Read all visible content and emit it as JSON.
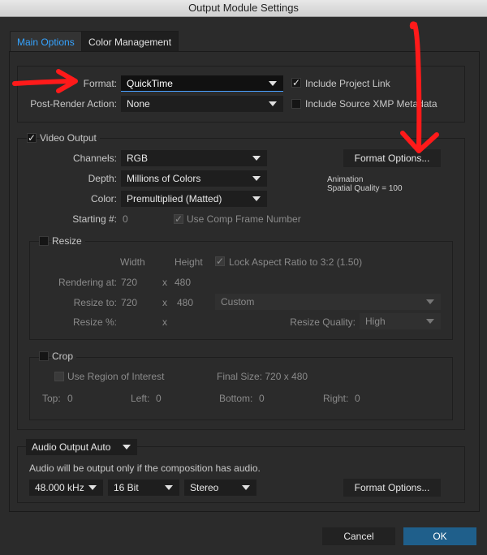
{
  "window": {
    "title": "Output Module Settings"
  },
  "tabs": {
    "main": "Main Options",
    "color": "Color Management"
  },
  "format": {
    "label": "Format:",
    "value": "QuickTime",
    "post_render_label": "Post-Render Action:",
    "post_render_value": "None",
    "include_project_link": "Include Project Link",
    "include_xmp": "Include Source XMP Metadata"
  },
  "video": {
    "section_label": "Video Output",
    "channels_label": "Channels:",
    "channels_value": "RGB",
    "depth_label": "Depth:",
    "depth_value": "Millions of Colors",
    "color_label": "Color:",
    "color_value": "Premultiplied (Matted)",
    "starting_label": "Starting #:",
    "starting_value": "0",
    "use_comp_frame": "Use Comp Frame Number",
    "format_options": "Format Options...",
    "codec_line1": "Animation",
    "codec_line2": "Spatial Quality = 100"
  },
  "resize": {
    "section_label": "Resize",
    "width_header": "Width",
    "height_header": "Height",
    "lock_aspect": "Lock Aspect Ratio to 3:2 (1.50)",
    "rendering_label": "Rendering at:",
    "rendering_w": "720",
    "rendering_h": "480",
    "resize_to_label": "Resize to:",
    "resize_w": "720",
    "resize_h": "480",
    "preset": "Custom",
    "percent_label": "Resize %:",
    "x": "x",
    "quality_label": "Resize Quality:",
    "quality_value": "High"
  },
  "crop": {
    "section_label": "Crop",
    "use_roi": "Use Region of Interest",
    "final_size": "Final Size: 720 x 480",
    "top_label": "Top:",
    "top_value": "0",
    "left_label": "Left:",
    "left_value": "0",
    "bottom_label": "Bottom:",
    "bottom_value": "0",
    "right_label": "Right:",
    "right_value": "0"
  },
  "audio": {
    "output_mode": "Audio Output Auto",
    "note": "Audio will be output only if the composition has audio.",
    "rate": "48.000 kHz",
    "bits": "16 Bit",
    "channels": "Stereo",
    "format_options": "Format Options..."
  },
  "footer": {
    "cancel": "Cancel",
    "ok": "OK"
  },
  "colors": {
    "accent": "#35a3ff",
    "ok_button": "#1f5f8b",
    "annotation": "#ff1a1a"
  }
}
